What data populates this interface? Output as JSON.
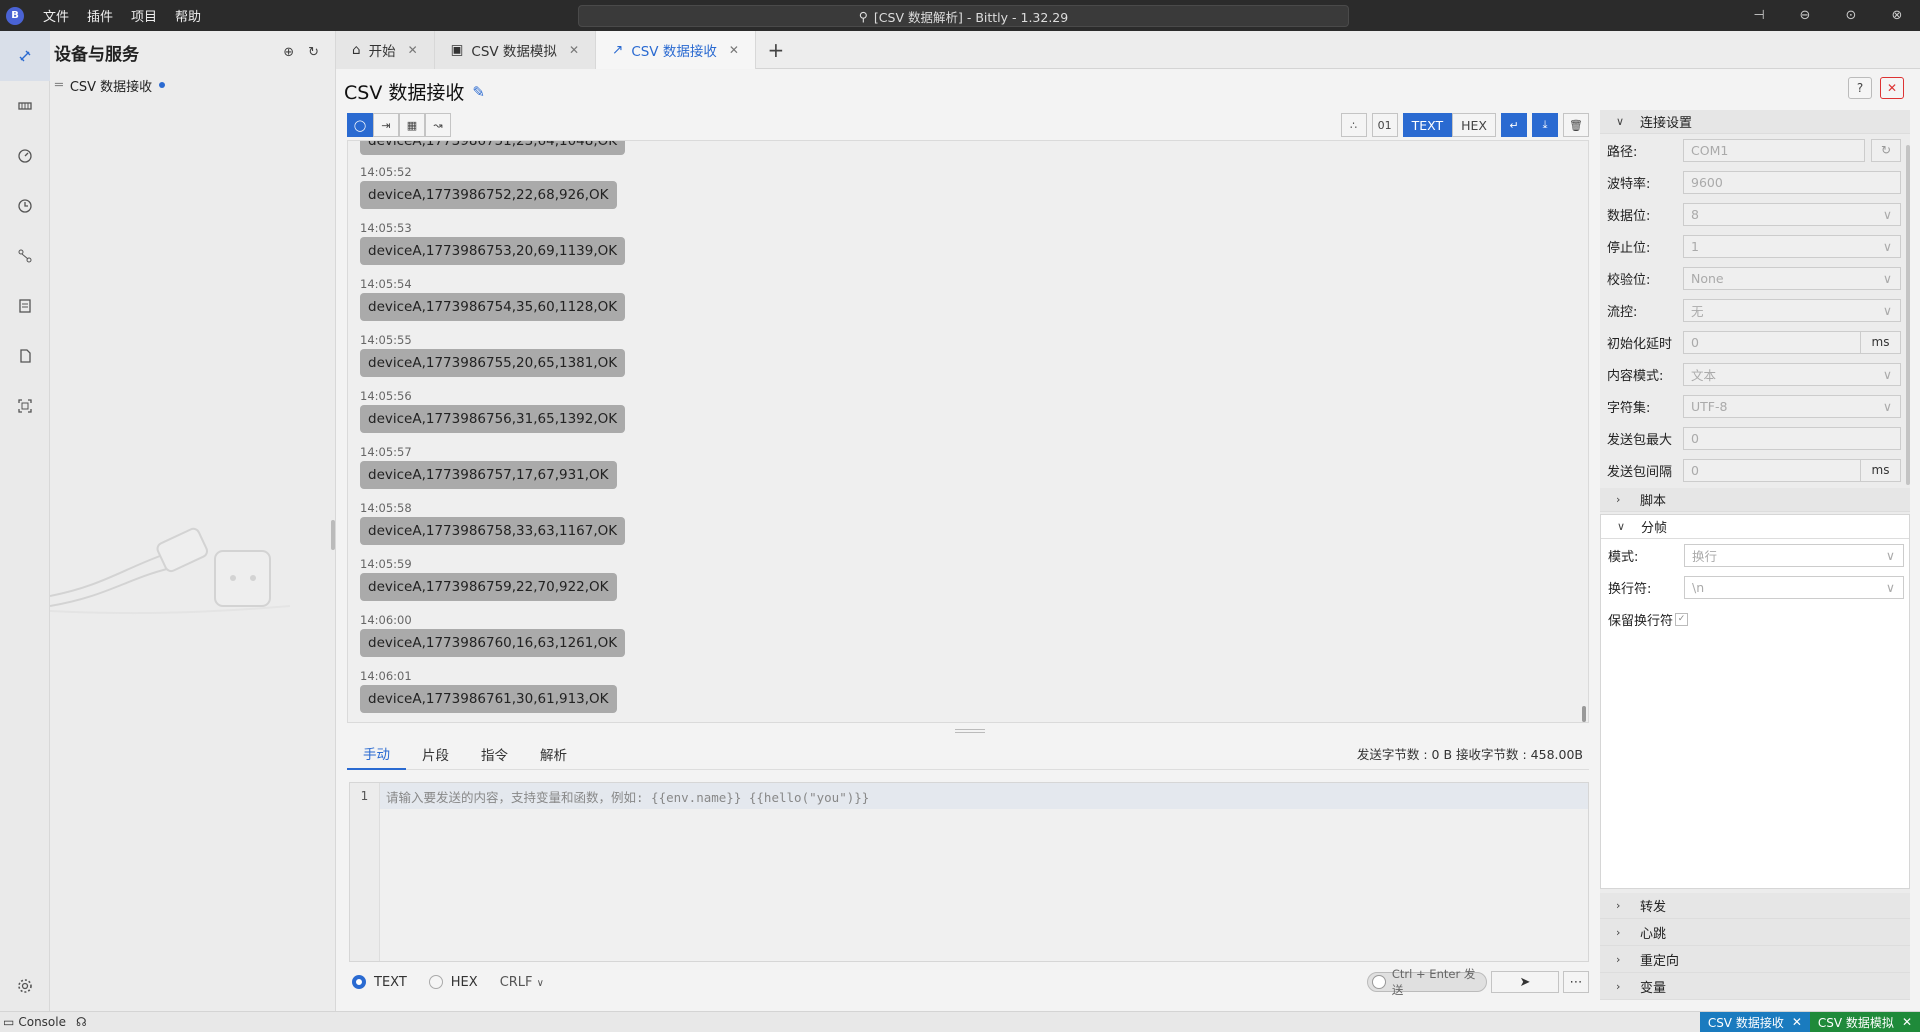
{
  "titlebar": {
    "menu": [
      "文件",
      "插件",
      "项目",
      "帮助"
    ],
    "search_text": "[CSV 数据解析] - Bittly - 1.32.29"
  },
  "sidebar": {
    "title": "设备与服务",
    "items": [
      {
        "label": "CSV 数据接收"
      }
    ]
  },
  "tabs": [
    {
      "label": "开始"
    },
    {
      "label": "CSV 数据模拟"
    },
    {
      "label": "CSV 数据接收",
      "active": true
    }
  ],
  "page": {
    "title": "CSV 数据接收"
  },
  "toolbar": {
    "byte_label": "01",
    "text_label": "TEXT",
    "hex_label": "HEX"
  },
  "messages": [
    {
      "time": "14:05:52",
      "text": "deviceA,1773986752,22,68,926,OK"
    },
    {
      "time": "14:05:53",
      "text": "deviceA,1773986753,20,69,1139,OK"
    },
    {
      "time": "14:05:54",
      "text": "deviceA,1773986754,35,60,1128,OK"
    },
    {
      "time": "14:05:55",
      "text": "deviceA,1773986755,20,65,1381,OK"
    },
    {
      "time": "14:05:56",
      "text": "deviceA,1773986756,31,65,1392,OK"
    },
    {
      "time": "14:05:57",
      "text": "deviceA,1773986757,17,67,931,OK"
    },
    {
      "time": "14:05:58",
      "text": "deviceA,1773986758,33,63,1167,OK"
    },
    {
      "time": "14:05:59",
      "text": "deviceA,1773986759,22,70,922,OK"
    },
    {
      "time": "14:06:00",
      "text": "deviceA,1773986760,16,63,1261,OK"
    },
    {
      "time": "14:06:01",
      "text": "deviceA,1773986761,30,61,913,OK"
    }
  ],
  "bottom": {
    "tabs": [
      "手动",
      "片段",
      "指令",
      "解析"
    ],
    "counts": "发送字节数 : 0 B  接收字节数 : 458.00B",
    "line_no": "1",
    "placeholder": "请输入要发送的内容，支持变量和函数，例如:  {{env.name}} {{hello(\"you\")}}",
    "mode_text": "TEXT",
    "mode_hex": "HEX",
    "eol": "CRLF",
    "send_hint": "Ctrl + Enter 发送"
  },
  "settings": {
    "connection_title": "连接设置",
    "fields": [
      {
        "label": "路径:",
        "value": "COM1"
      },
      {
        "label": "波特率:",
        "value": "9600"
      },
      {
        "label": "数据位:",
        "value": "8"
      },
      {
        "label": "停止位:",
        "value": "1"
      },
      {
        "label": "校验位:",
        "value": "None"
      },
      {
        "label": "流控:",
        "value": "无"
      },
      {
        "label": "初始化延时",
        "value": "0",
        "unit": "ms"
      },
      {
        "label": "内容模式:",
        "value": "文本"
      },
      {
        "label": "字符集:",
        "value": "UTF-8"
      },
      {
        "label": "发送包最大",
        "value": "0"
      },
      {
        "label": "发送包间隔",
        "value": "0",
        "unit": "ms"
      }
    ],
    "script_title": "脚本",
    "frame_title": "分帧",
    "frame_fields": [
      {
        "label": "模式:",
        "value": "换行"
      },
      {
        "label": "换行符:",
        "value": "\\n"
      }
    ],
    "keep_eol_label": "保留换行符",
    "collapsed": [
      "转发",
      "心跳",
      "重定向",
      "变量"
    ]
  },
  "statusbar": {
    "console_label": "Console",
    "tabs": [
      {
        "label": "CSV 数据接收",
        "color": "#1a7bbf"
      },
      {
        "label": "CSV 数据模拟",
        "color": "#1f8a3a"
      }
    ]
  }
}
